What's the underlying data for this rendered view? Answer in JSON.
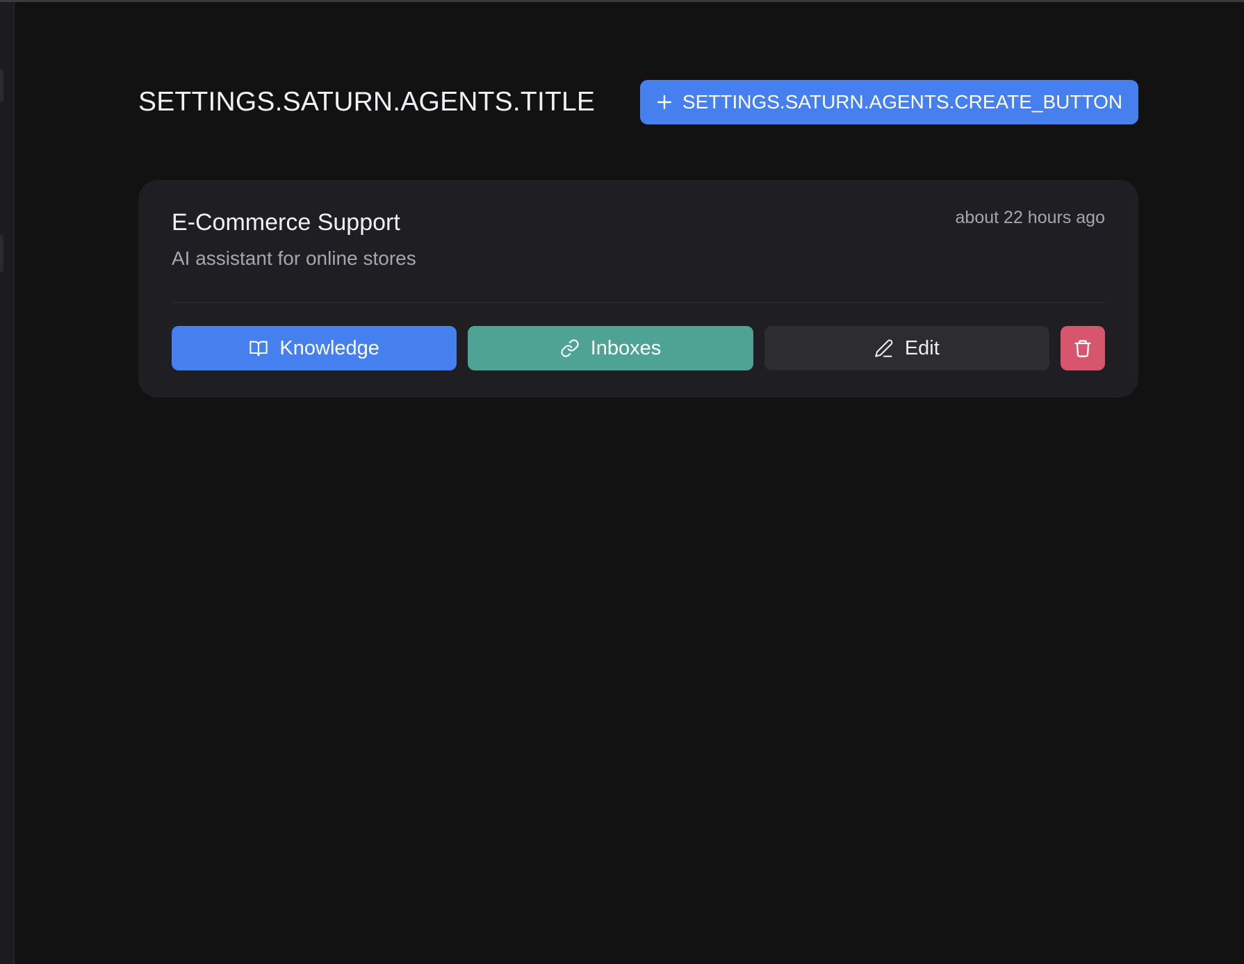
{
  "header": {
    "title": "SETTINGS.SATURN.AGENTS.TITLE",
    "create_button_label": "SETTINGS.SATURN.AGENTS.CREATE_BUTTON",
    "create_button_icon": "plus-icon"
  },
  "agents": [
    {
      "name": "E-Commerce Support",
      "description": "AI assistant for online stores",
      "updated": "about 22 hours ago",
      "actions": {
        "knowledge_label": "Knowledge",
        "knowledge_icon": "book-open-icon",
        "inboxes_label": "Inboxes",
        "inboxes_icon": "link-icon",
        "edit_label": "Edit",
        "edit_icon": "pencil-icon",
        "delete_icon": "trash-icon"
      }
    }
  ],
  "colors": {
    "background": "#121213",
    "card": "#1f1f23",
    "primary": "#4680ee",
    "teal": "#4ea394",
    "neutral_button": "#2c2c31",
    "danger": "#d6566d",
    "muted_text": "#a6a6ad"
  }
}
